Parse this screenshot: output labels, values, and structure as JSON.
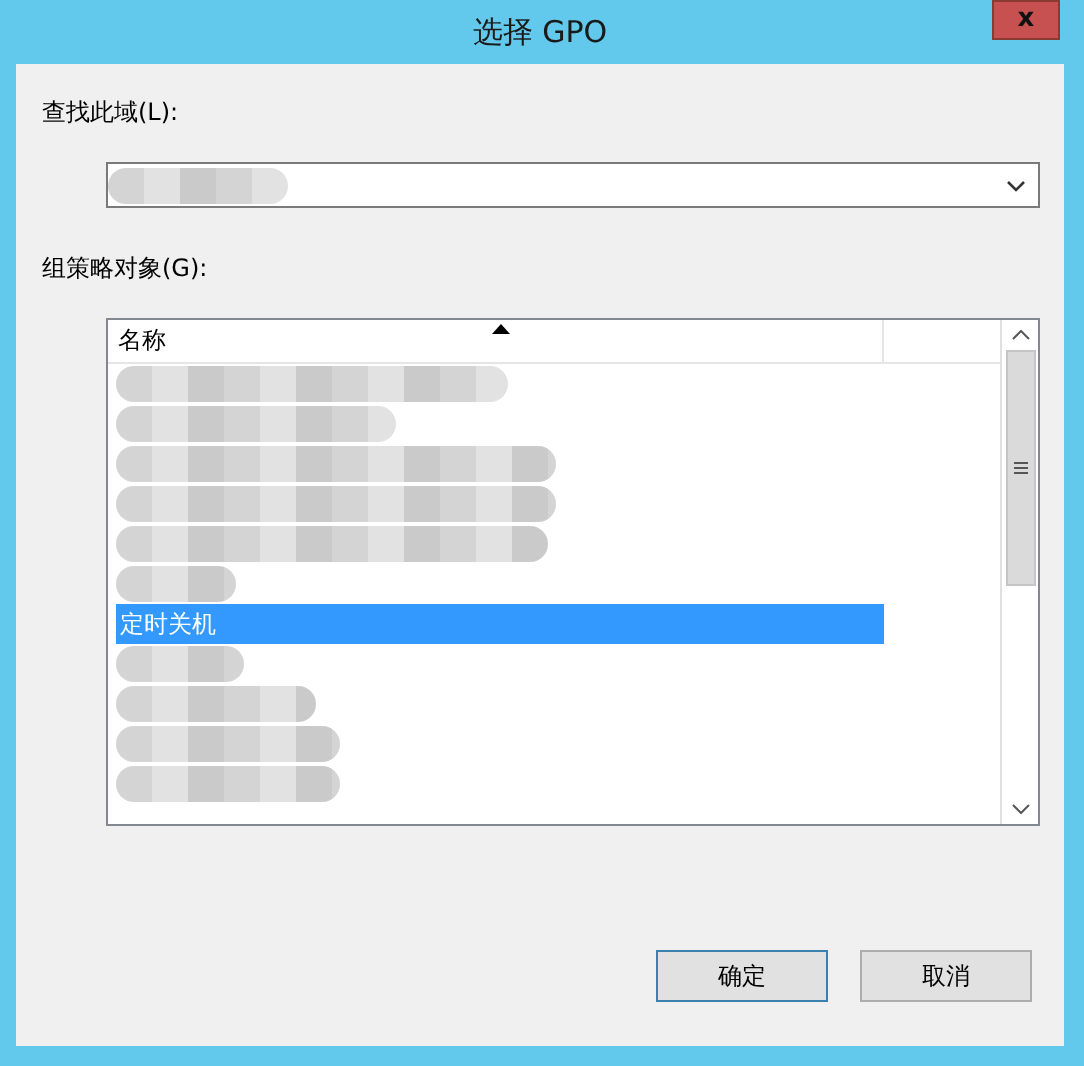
{
  "window": {
    "title": "选择 GPO",
    "close": "x"
  },
  "domain": {
    "label": "查找此域(L):",
    "value": {
      "kind": "redacted"
    }
  },
  "gpo_list": {
    "label": "组策略对象(G):",
    "columns": [
      {
        "title": "名称",
        "sorted": true
      }
    ],
    "rows": [
      {
        "kind": "redacted",
        "selected": false
      },
      {
        "kind": "redacted",
        "selected": false
      },
      {
        "kind": "redacted",
        "selected": false
      },
      {
        "kind": "redacted",
        "selected": false
      },
      {
        "kind": "redacted",
        "selected": false
      },
      {
        "kind": "redacted",
        "selected": false
      },
      {
        "kind": "text",
        "name": "定时关机",
        "selected": true
      },
      {
        "kind": "redacted",
        "selected": false
      },
      {
        "kind": "redacted",
        "selected": false
      },
      {
        "kind": "redacted",
        "selected": false
      },
      {
        "kind": "redacted",
        "selected": false
      }
    ]
  },
  "buttons": [
    {
      "label": "确定",
      "default": true
    },
    {
      "label": "取消",
      "default": false
    }
  ]
}
